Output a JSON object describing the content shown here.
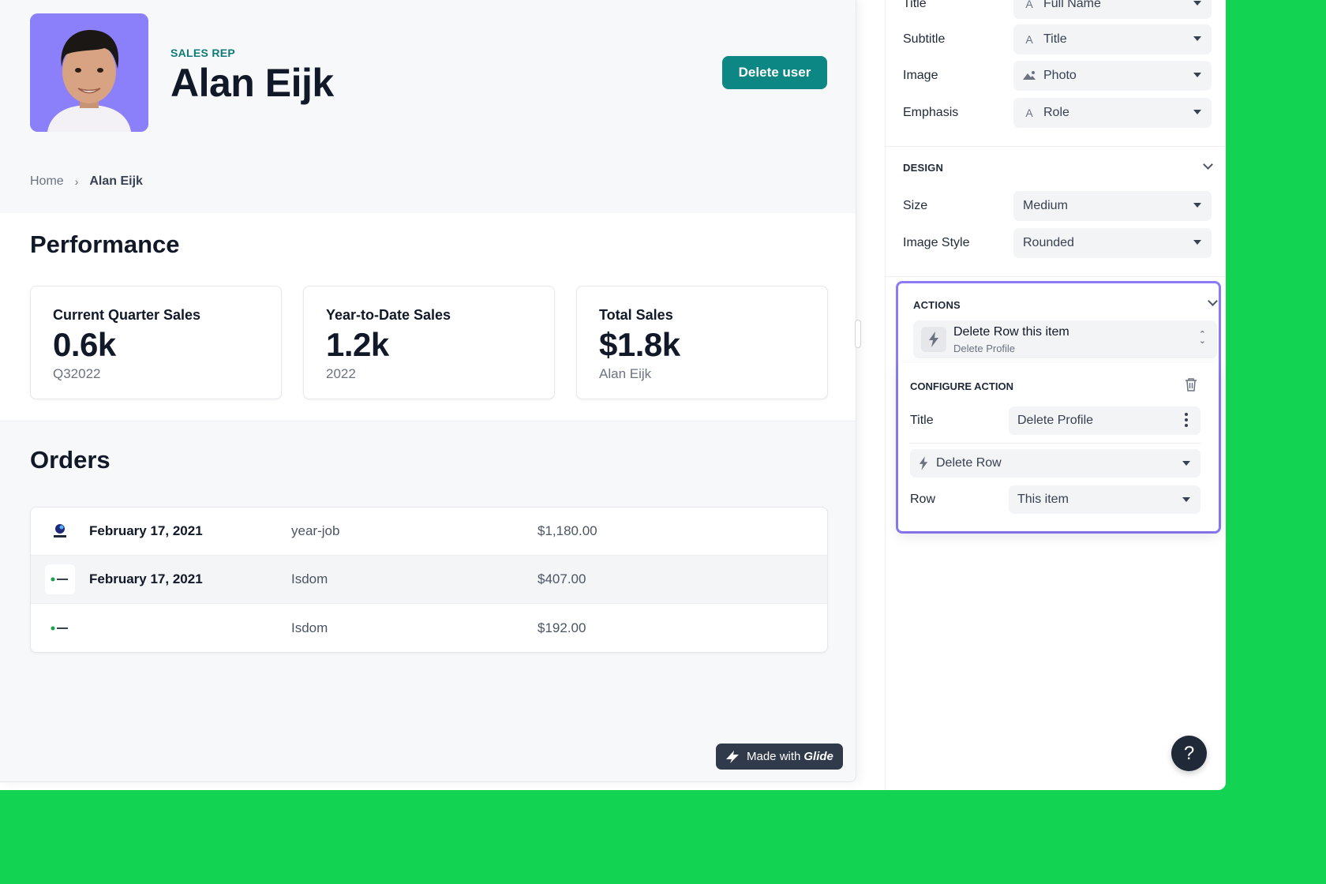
{
  "profile": {
    "eyebrow": "SALES REP",
    "name": "Alan Eijk",
    "delete_label": "Delete user",
    "avatar_bg": "#8b80f9"
  },
  "breadcrumb": {
    "home": "Home",
    "current": "Alan Eijk"
  },
  "performance": {
    "title": "Performance",
    "cards": [
      {
        "label": "Current Quarter Sales",
        "value": "0.6k",
        "sub": "Q32022"
      },
      {
        "label": "Year-to-Date Sales",
        "value": "1.2k",
        "sub": "2022"
      },
      {
        "label": "Total Sales",
        "value": "$1.8k",
        "sub": "Alan Eijk"
      }
    ]
  },
  "orders": {
    "title": "Orders",
    "rows": [
      {
        "date": "February 17, 2021",
        "customer": "year-job",
        "amount": "$1,180.00",
        "logo_text": "Year-job"
      },
      {
        "date": "February 17, 2021",
        "customer": "Isdom",
        "amount": "$407.00",
        "logo_text": "Isdom"
      },
      {
        "date": "",
        "customer": "Isdom",
        "amount": "$192.00",
        "logo_text": "Isdom"
      }
    ]
  },
  "badge": {
    "prefix": "Made with",
    "brand": "Glide"
  },
  "panel": {
    "properties": [
      {
        "label": "Title",
        "value": "Full Name",
        "icon": "text-icon"
      },
      {
        "label": "Subtitle",
        "value": "Title",
        "icon": "text-icon"
      },
      {
        "label": "Image",
        "value": "Photo",
        "icon": "image-icon"
      },
      {
        "label": "Emphasis",
        "value": "Role",
        "icon": "text-icon"
      }
    ],
    "design": {
      "heading": "DESIGN",
      "size_label": "Size",
      "size_value": "Medium",
      "image_style_label": "Image Style",
      "image_style_value": "Rounded"
    },
    "actions": {
      "heading": "ACTIONS",
      "item_title": "Delete Row this item",
      "item_sub": "Delete Profile",
      "configure_heading": "CONFIGURE ACTION",
      "title_label": "Title",
      "title_value": "Delete Profile",
      "action_value": "Delete Row",
      "row_label": "Row",
      "row_value": "This item"
    },
    "help": "?"
  },
  "colors": {
    "accent": "#0c8784",
    "highlight": "#8b7cf6",
    "background": "#12d352"
  }
}
